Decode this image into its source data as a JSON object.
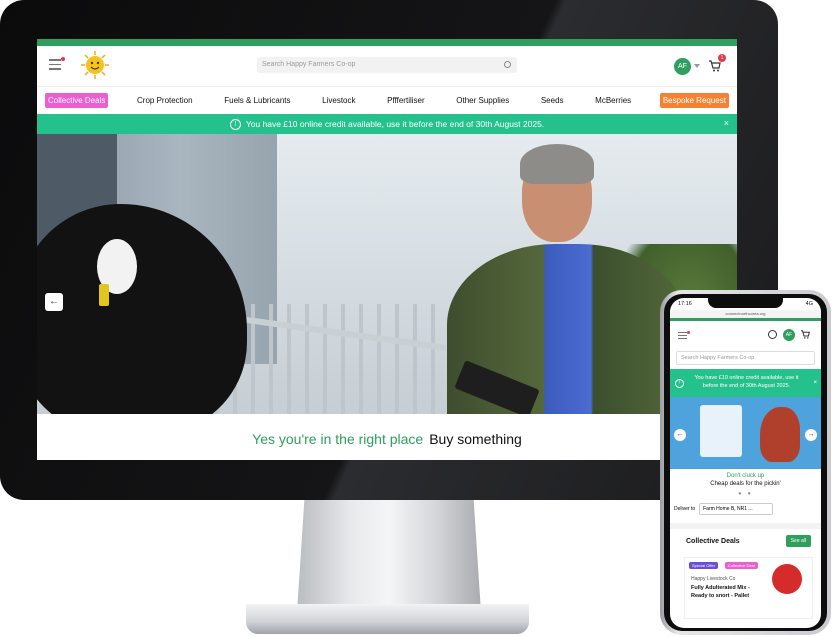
{
  "desktop": {
    "search_placeholder": "Search Happy Farmers Co-op",
    "avatar_initials": "AF",
    "cart_count": "1",
    "nav": [
      "Collective Deals",
      "Crop Protection",
      "Fuels & Lubricants",
      "Livestock",
      "Pfffertiliser",
      "Other Supplies",
      "Seeds",
      "McBerries",
      "Bespoke Request"
    ],
    "credit_banner": "You have £10 online credit available, use it before the end of 30th August 2025.",
    "close_glyph": "×",
    "hero_prev_glyph": "←",
    "tagline_green": "Yes you're in the right place",
    "tagline_dark": "Buy something",
    "colors": {
      "brand_green": "#2f9e5e",
      "credit_green": "#25c18d",
      "pink": "#ec5fd0",
      "orange": "#f58232"
    }
  },
  "phone": {
    "time": "17:16",
    "signal": "4G",
    "url": "connectnorthcorea.org",
    "avatar_initials": "AF",
    "search_placeholder": "Search Happy Farmers Co-op",
    "credit_banner": "You have £10 online credit available, use it before the end of 30th August 2025.",
    "tagline_1": "Don't cluck up",
    "tagline_2": "Cheap deals for the pickin'",
    "deliver_label": "Deliver to",
    "deliver_value": "Farm Home B, NR1 ...",
    "collective_title": "Collective Deals",
    "see_all": "See all",
    "card": {
      "badge_1": "Special Offer",
      "badge_2": "Collective Deal",
      "seller": "Happy Livestock Co",
      "name": "Fully Adulterated Mix - Ready to snort - Pallet"
    }
  }
}
